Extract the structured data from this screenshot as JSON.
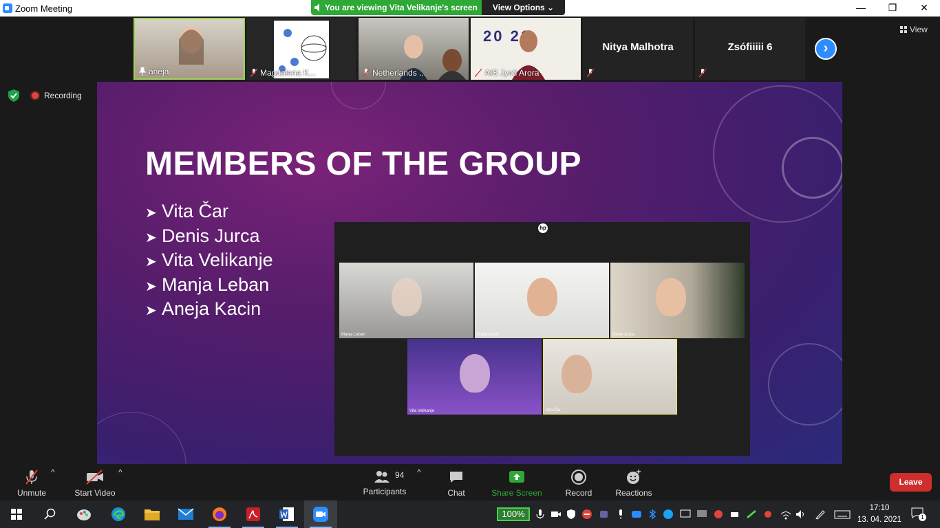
{
  "window": {
    "title": "Zoom Meeting"
  },
  "banner": {
    "viewing_text": "You are viewing Vita Velikanje's screen",
    "view_options_label": "View Options ⌄"
  },
  "thumbnails": [
    {
      "name": "aneja"
    },
    {
      "name": "Magdalena K..."
    },
    {
      "name": "Netherlands ..."
    },
    {
      "name": "AIS Jyoti Arora",
      "poster_text": "20  21"
    },
    {
      "name": "Nitya Malhotra"
    },
    {
      "name": "Zsófiiiii 6"
    }
  ],
  "view_button": {
    "label": "View"
  },
  "recording": {
    "label": "Recording"
  },
  "slide": {
    "title": "MEMBERS OF THE GROUP",
    "members": [
      "Vita Čar",
      "Denis Jurca",
      "Vita Velikanje",
      "Manja Leban",
      "Aneja Kacin"
    ],
    "embedded_logo": "hp",
    "tiles": [
      "Manja Leban",
      "Aneja Kacin",
      "Denis Jurca",
      "Vita Velikanje",
      "Vita Čar"
    ]
  },
  "toolbar": {
    "unmute": "Unmute",
    "start_video": "Start Video",
    "participants": "Participants",
    "participant_count": "94",
    "chat": "Chat",
    "share_screen": "Share Screen",
    "record": "Record",
    "reactions": "Reactions",
    "leave": "Leave"
  },
  "taskbar": {
    "battery": "100%",
    "time": "17:10",
    "date": "13. 04. 2021",
    "notification_count": "1"
  },
  "colors": {
    "zoom_blue": "#2d8cff",
    "share_green": "#2ea836",
    "leave_red": "#cf2e2e"
  }
}
